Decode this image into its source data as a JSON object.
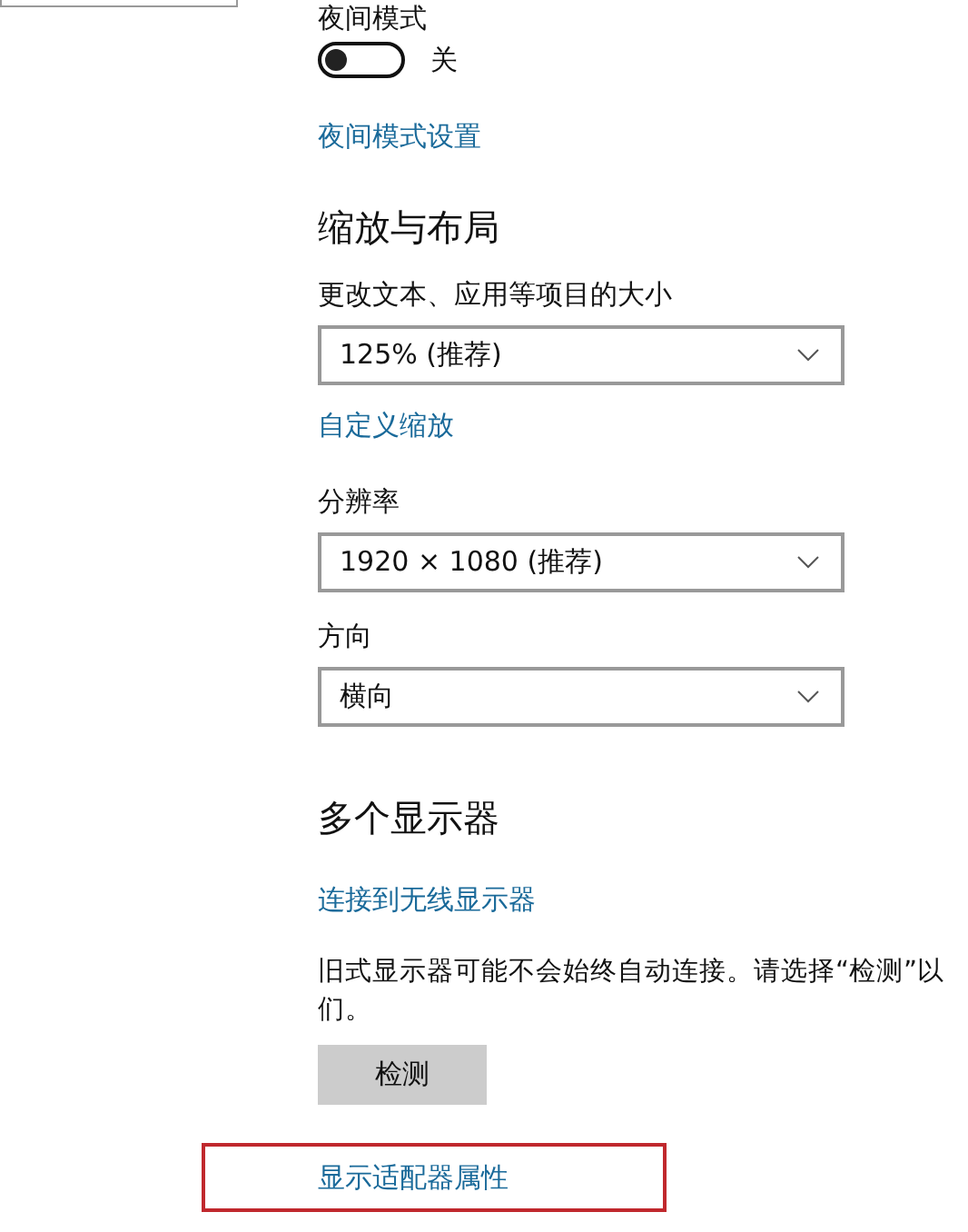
{
  "night_light": {
    "label": "夜间模式",
    "on": false,
    "state_text": "关",
    "settings_link": "夜间模式设置"
  },
  "scale_layout": {
    "heading": "缩放与布局",
    "fields": [
      {
        "label": "更改文本、应用等项目的大小",
        "value": "125% (推荐)"
      },
      {
        "link": "自定义缩放"
      },
      {
        "label": "分辨率",
        "value": "1920 × 1080 (推荐)"
      },
      {
        "label": "方向",
        "value": "横向"
      }
    ]
  },
  "multiple_displays": {
    "heading": "多个显示器",
    "link": "连接到无线显示器",
    "notice_lines": [
      "旧式显示器可能不会始终自动连接。请选择“检测”以",
      "们。"
    ],
    "detect_button": "检测",
    "adapter_link": {
      "text": "显示适配器属性",
      "highlighted": true
    }
  }
}
